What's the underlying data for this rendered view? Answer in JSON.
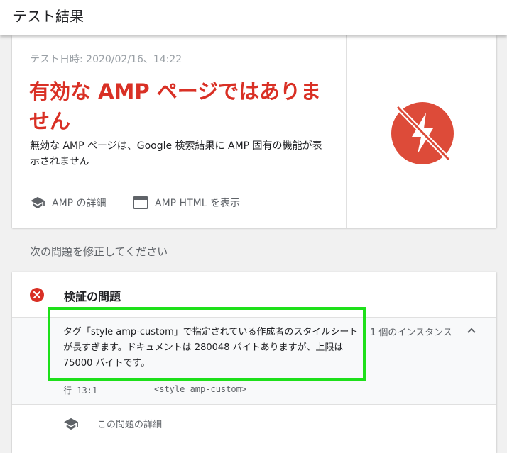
{
  "header": {
    "title": "テスト結果"
  },
  "result": {
    "test_date": "テスト日時: 2020/02/16、14:22",
    "headline": "有効な AMP ページではありません",
    "description": "無効な AMP ページは、Google 検索結果に AMP 固有の機能が表示されません",
    "links": [
      {
        "label": "AMP の詳細",
        "icon": "school-icon"
      },
      {
        "label": "AMP HTML を表示",
        "icon": "browser-window-icon"
      }
    ],
    "status_icon": "amp-invalid-icon",
    "status_color": "#dd4b39"
  },
  "section_title": "次の問題を修正してください",
  "issues": {
    "title": "検証の問題",
    "message": "タグ「style amp-custom」で指定されている作成者のスタイルシートが長すぎます。ドキュメントは 280048 バイトありますが、上限は 75000 バイトです。",
    "instances": "1 個のインスタンス",
    "code_line": "行 13:1",
    "code_tag": "<style amp-custom>",
    "detail_label": "この問題の詳細"
  },
  "colors": {
    "error": "#d93025",
    "highlight": "#1ee01a"
  }
}
